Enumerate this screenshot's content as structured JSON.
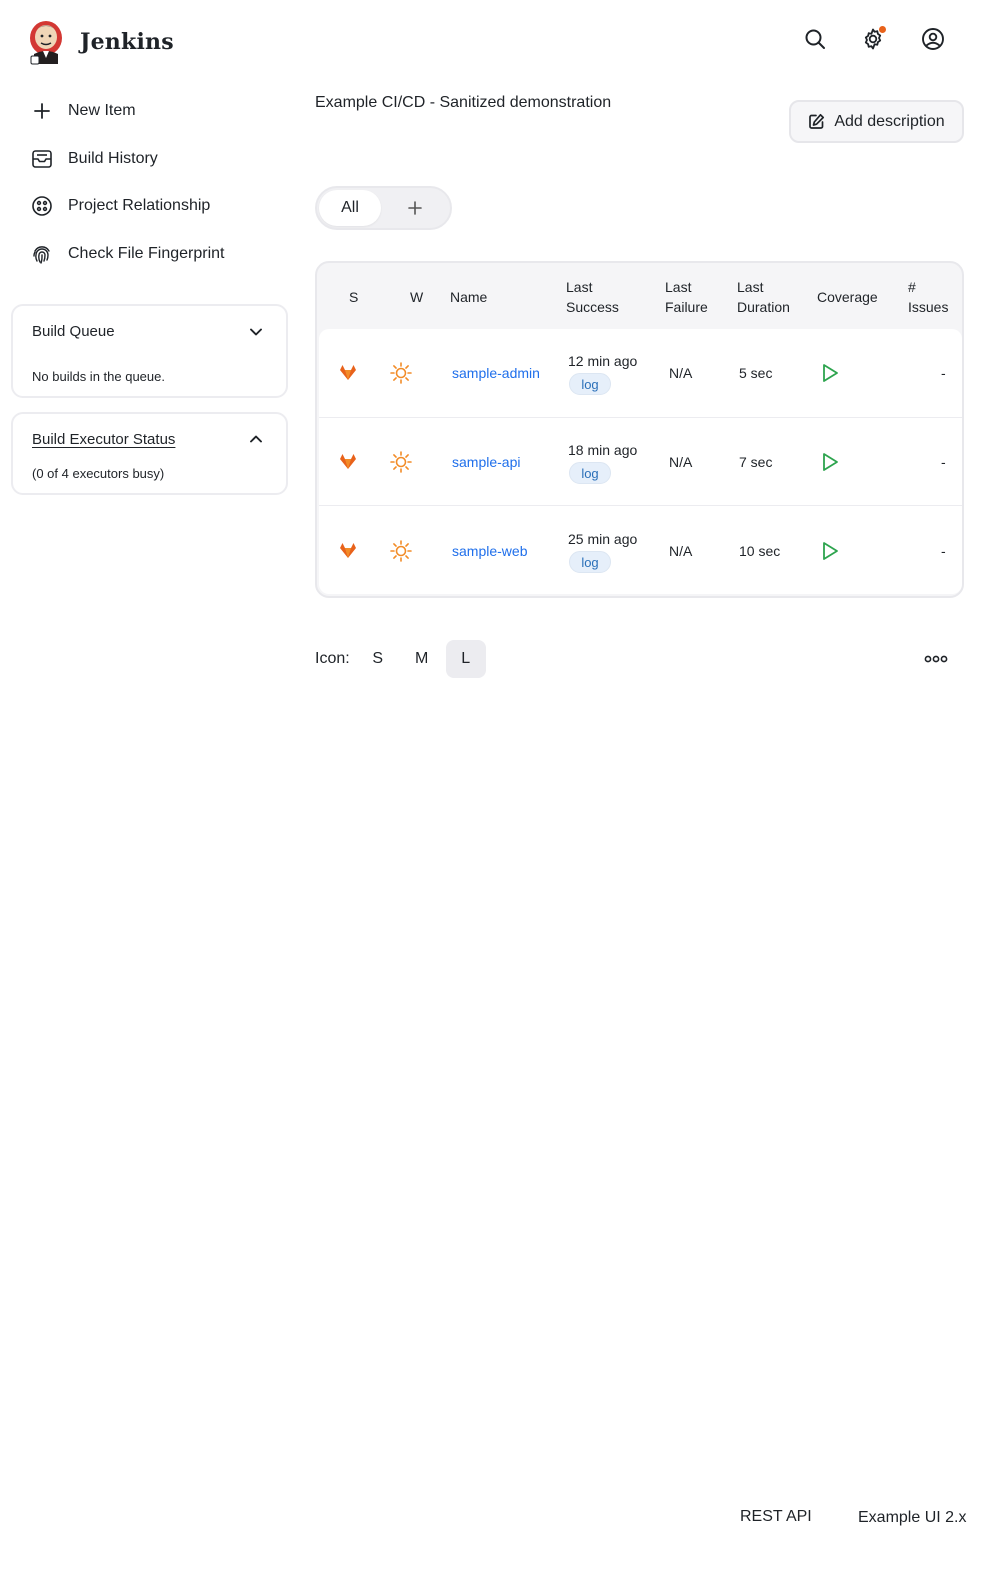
{
  "header": {
    "brand": "Jenkins",
    "icons": [
      "search-icon",
      "gear-icon",
      "user-circle-icon"
    ],
    "notification_color": "#e8621b"
  },
  "sidebar": {
    "items": [
      {
        "label": "New Item",
        "icon": "plus-icon"
      },
      {
        "label": "Build History",
        "icon": "inbox-icon"
      },
      {
        "label": "Project Relationship",
        "icon": "relationship-icon"
      },
      {
        "label": "Check File Fingerprint",
        "icon": "fingerprint-icon"
      }
    ],
    "build_queue": {
      "title": "Build Queue",
      "status": "No builds in the queue."
    },
    "executor_status": {
      "title": "Build Executor Status",
      "status": "(0 of 4 executors busy)"
    }
  },
  "main": {
    "description": "Example CI/CD - Sanitized demonstration",
    "add_description_label": "Add description",
    "tabs": [
      {
        "label": "All"
      },
      {
        "label": "+"
      }
    ]
  },
  "table": {
    "headers": {
      "s": "S",
      "w": "W",
      "name": "Name",
      "last_success_1": "Last",
      "last_success_2": "Success",
      "last_failure_1": "Last",
      "last_failure_2": "Failure",
      "last_duration_1": "Last",
      "last_duration_2": "Duration",
      "coverage": "Coverage",
      "issues_1": "#",
      "issues_2": "Issues"
    },
    "rows": [
      {
        "name": "sample-admin",
        "last_success": "12 min ago",
        "log": "log",
        "last_failure": "N/A",
        "last_duration": "5 sec",
        "issues": "-"
      },
      {
        "name": "sample-api",
        "last_success": "18 min ago",
        "log": "log",
        "last_failure": "N/A",
        "last_duration": "7 sec",
        "issues": "-"
      },
      {
        "name": "sample-web",
        "last_success": "25 min ago",
        "log": "log",
        "last_failure": "N/A",
        "last_duration": "10 sec",
        "issues": "-"
      }
    ],
    "status_icon": "gitlab-fox-icon",
    "weather_icon": "sun-icon",
    "coverage_icon": "play-icon",
    "colors": {
      "status": "#e8621b",
      "weather": "#f28c28",
      "coverage": "#2da44e",
      "link": "#1f6feb"
    }
  },
  "icon_size": {
    "label": "Icon:",
    "options": [
      "S",
      "M",
      "L"
    ],
    "selected": "L"
  },
  "footer": {
    "rest_api": "REST API",
    "version": "Example UI 2.x"
  }
}
